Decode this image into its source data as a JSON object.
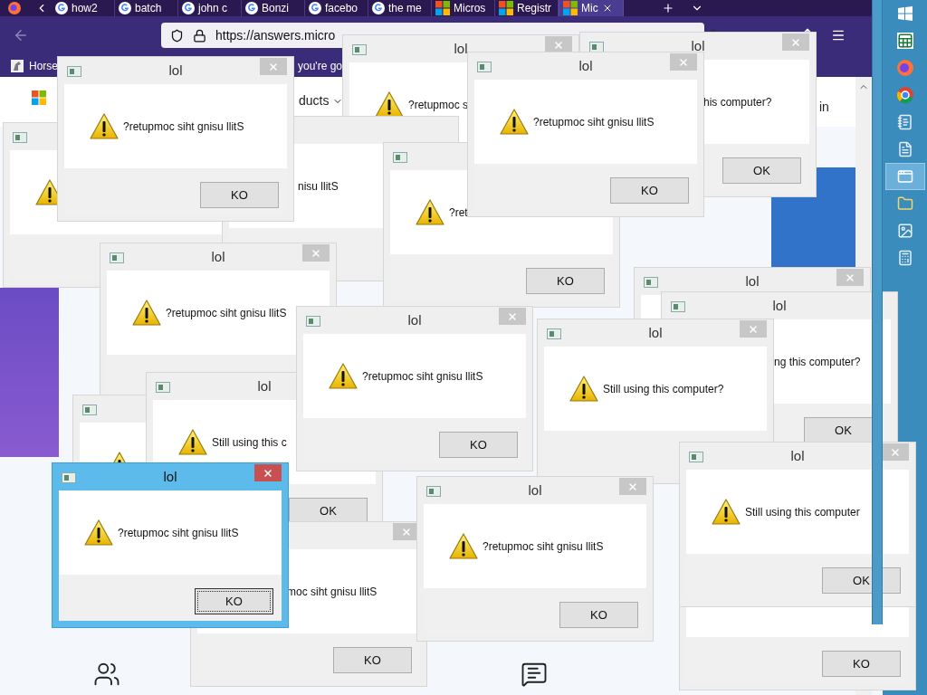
{
  "browser": {
    "tabs": [
      {
        "label": "how2",
        "selected": false
      },
      {
        "label": "batch",
        "selected": false
      },
      {
        "label": "john c",
        "selected": false
      },
      {
        "label": "Bonzi",
        "selected": false
      },
      {
        "label": "facebo",
        "selected": false
      },
      {
        "label": "the me",
        "selected": false
      },
      {
        "label": "Micros",
        "selected": false
      },
      {
        "label": "Registr",
        "selected": false
      },
      {
        "label": "Mic",
        "selected": true
      }
    ],
    "address": "https://answers.micro",
    "bookmarks": [
      "Horse",
      "you're go"
    ],
    "page": {
      "nav_text": "ducts",
      "sign_in": "in"
    }
  },
  "dialogs": [
    {
      "active": false
    },
    {
      "title": "lol",
      "message": "?retupmoc s",
      "active": false
    },
    {
      "title": "lol",
      "message": "his computer?",
      "button": "OK",
      "active": false
    },
    {
      "message": "nisu llitS",
      "active": false
    },
    {
      "title": "lol",
      "message": "?retupmoc siht gnisu llitS",
      "button": "KO",
      "active": false
    },
    {
      "message": "?ret",
      "button": "KO",
      "active": false
    },
    {
      "title": "lol",
      "message": "?retupmoc siht gnisu llitS",
      "button": "KO",
      "active": false
    },
    {
      "title": "lol",
      "message": "?retupmoc siht gnisu llitS",
      "active": false
    },
    {
      "title": "lol",
      "active": false
    },
    {
      "title": "lol",
      "message": "ng this computer?",
      "button": "OK",
      "active": false
    },
    {
      "active": false
    },
    {
      "title": "lol",
      "message": "Still using this c",
      "button": "OK",
      "active": false
    },
    {
      "title": "lol",
      "message": "?retupmoc siht gnisu llitS",
      "button": "KO",
      "active": false
    },
    {
      "title": "lol",
      "message": "Still using this computer?",
      "active": false
    },
    {
      "message": "moc siht gnisu llitS",
      "button": "KO",
      "active": false
    },
    {
      "title": "lol",
      "message": "?retupmoc siht gnisu llitS",
      "button": "KO",
      "active": false
    },
    {
      "title": "lol",
      "message": "Still using this computer",
      "button": "OK",
      "active": false
    },
    {
      "button": "KO",
      "active": false
    },
    {
      "title": "lol",
      "message": "?retupmoc siht gnisu llitS",
      "button": "KO",
      "active": true
    }
  ]
}
